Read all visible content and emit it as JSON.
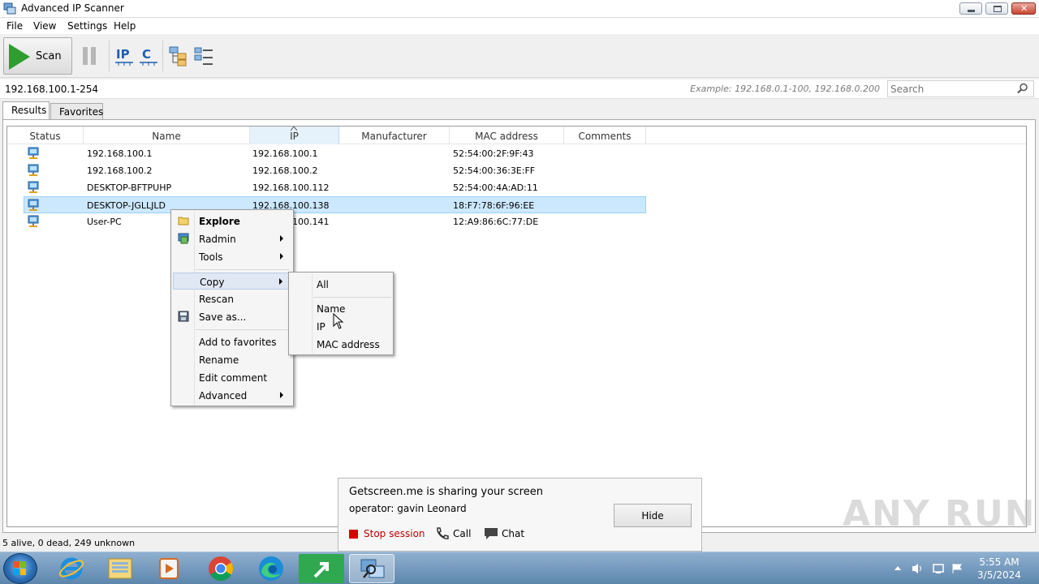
{
  "window": {
    "title": "Advanced IP Scanner"
  },
  "menubar": {
    "items": [
      "File",
      "View",
      "Settings",
      "Help"
    ]
  },
  "toolbar": {
    "scan_label": "Scan"
  },
  "address": {
    "range": "192.168.100.1-254",
    "example": "Example: 192.168.0.1-100, 192.168.0.200",
    "search_placeholder": "Search"
  },
  "tabs": [
    "Results",
    "Favorites"
  ],
  "table": {
    "columns": [
      "Status",
      "Name",
      "IP",
      "Manufacturer",
      "MAC address",
      "Comments"
    ],
    "rows": [
      {
        "name": "192.168.100.1",
        "ip": "192.168.100.1",
        "manufacturer": "",
        "mac": "52:54:00:2F:9F:43",
        "comments": ""
      },
      {
        "name": "192.168.100.2",
        "ip": "192.168.100.2",
        "manufacturer": "",
        "mac": "52:54:00:36:3E:FF",
        "comments": ""
      },
      {
        "name": "DESKTOP-BFTPUHP",
        "ip": "192.168.100.112",
        "manufacturer": "",
        "mac": "52:54:00:4A:AD:11",
        "comments": ""
      },
      {
        "name": "DESKTOP-JGLLJLD",
        "ip": "192.168.100.138",
        "manufacturer": "",
        "mac": "18:F7:78:6F:96:EE",
        "comments": ""
      },
      {
        "name": "User-PC",
        "ip": "192.168.100.141",
        "manufacturer": "",
        "mac": "12:A9:86:6C:77:DE",
        "comments": ""
      }
    ],
    "selected_row": 3
  },
  "context_menu": {
    "items": [
      "Explore",
      "Radmin",
      "Tools",
      "Copy",
      "Rescan",
      "Save as...",
      "Add to favorites",
      "Rename",
      "Edit comment",
      "Advanced"
    ]
  },
  "copy_submenu": {
    "items": [
      "All",
      "Name",
      "IP",
      "MAC address"
    ]
  },
  "statusbar": {
    "text": "5 alive, 0 dead, 249 unknown"
  },
  "share_popup": {
    "line1": "Getscreen.me is sharing your screen",
    "line2": "operator: gavin Leonard",
    "hide_label": "Hide",
    "stop_label": "Stop session",
    "call_label": "Call",
    "chat_label": "Chat"
  },
  "watermark": "ANY RUN",
  "taskbar": {
    "apps": [
      "internet-explorer-icon",
      "file-explorer-icon",
      "media-player-icon",
      "chrome-icon",
      "edge-icon",
      "getscreen-icon",
      "advanced-ip-scanner-icon"
    ],
    "time": "5:55 AM",
    "date": "3/5/2024"
  },
  "colors": {
    "selection": "#cce8ff",
    "play_green": "#2f9d2f",
    "stop_red": "#d40000"
  }
}
